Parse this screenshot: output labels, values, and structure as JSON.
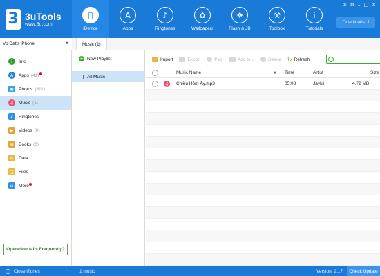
{
  "app": {
    "name": "3uTools",
    "url": "www.3u.com",
    "logo_mark": "3",
    "downloads_label": "Downloads",
    "window_controls": [
      "♔",
      "⚙",
      "–",
      "□",
      "✕"
    ]
  },
  "nav": [
    {
      "label": "iDevice",
      "icon": "apple-icon",
      "glyph": "",
      "active": true
    },
    {
      "label": "Apps",
      "icon": "appstore-icon",
      "glyph": "A",
      "active": false
    },
    {
      "label": "Ringtones",
      "icon": "bell-icon",
      "glyph": "♪",
      "active": false
    },
    {
      "label": "Wallpapers",
      "icon": "flower-icon",
      "glyph": "✿",
      "active": false
    },
    {
      "label": "Flash & JB",
      "icon": "dropbox-icon",
      "glyph": "❖",
      "active": false
    },
    {
      "label": "Toolbox",
      "icon": "tools-icon",
      "glyph": "⚒",
      "active": false
    },
    {
      "label": "Tutorials",
      "icon": "info-icon",
      "glyph": "i",
      "active": false
    }
  ],
  "device_name": "Vo Dat's iPhone",
  "sidebar": {
    "items": [
      {
        "label": "Info",
        "count": "",
        "icon": "info-icon",
        "glyph": "i",
        "color": "#33a02c",
        "red_dot": false
      },
      {
        "label": "Apps",
        "count": "(41)",
        "icon": "apps-icon",
        "glyph": "A",
        "color": "#1f86e0",
        "red_dot": true
      },
      {
        "label": "Photos",
        "count": "(611)",
        "icon": "photos-icon",
        "glyph": "▣",
        "color": "#3aa0e8",
        "red_dot": false
      },
      {
        "label": "Music",
        "count": "(1)",
        "icon": "music-icon",
        "glyph": "♫",
        "color": "#ea4e6b",
        "red_dot": false
      },
      {
        "label": "Ringtones",
        "count": "",
        "icon": "ringtones-icon",
        "glyph": "♪",
        "color": "#2d8fe5",
        "red_dot": false
      },
      {
        "label": "Videos",
        "count": "(0)",
        "icon": "videos-icon",
        "glyph": "▶",
        "color": "#e8a030",
        "red_dot": false
      },
      {
        "label": "Books",
        "count": "(0)",
        "icon": "books-icon",
        "glyph": "▤",
        "color": "#e6a53a",
        "red_dot": false
      },
      {
        "label": "Data",
        "count": "",
        "icon": "data-icon",
        "glyph": "≡",
        "color": "#e8b845",
        "red_dot": false
      },
      {
        "label": "Files",
        "count": "",
        "icon": "files-icon",
        "glyph": "□",
        "color": "#e8b845",
        "red_dot": false
      },
      {
        "label": "More",
        "count": "",
        "icon": "more-icon",
        "glyph": "☷",
        "color": "#2d8fe5",
        "red_dot": true
      }
    ],
    "active_index": 3,
    "operation_button": "Operation fails Frequently?"
  },
  "tabs": [
    {
      "label": "Music (1)"
    }
  ],
  "playlists": {
    "new_label": "New Playlist",
    "items": [
      {
        "label": "All Music"
      }
    ]
  },
  "toolbar": {
    "import": "Import",
    "export": "Export",
    "play": "Play",
    "add_to": "Add to...",
    "delete": "Delete",
    "refresh": "Refresh"
  },
  "table": {
    "columns": {
      "name": "Music Name",
      "time": "Time",
      "artist": "Artist",
      "size": "Size"
    },
    "rows": [
      {
        "name": "Chiều Hôm Ấy.mp3",
        "time": "05:08",
        "artist": "Jaykii",
        "size": "4.72 MB"
      }
    ]
  },
  "statusbar": {
    "close_itunes": "Close iTunes",
    "count": "1 music",
    "version": "Version: 2.17",
    "check_update": "Check Update"
  },
  "colors": {
    "header": "#1a7ad8",
    "active_nav": "#2588e6",
    "selection": "#cde3f7",
    "accent_green": "#3ab034"
  }
}
